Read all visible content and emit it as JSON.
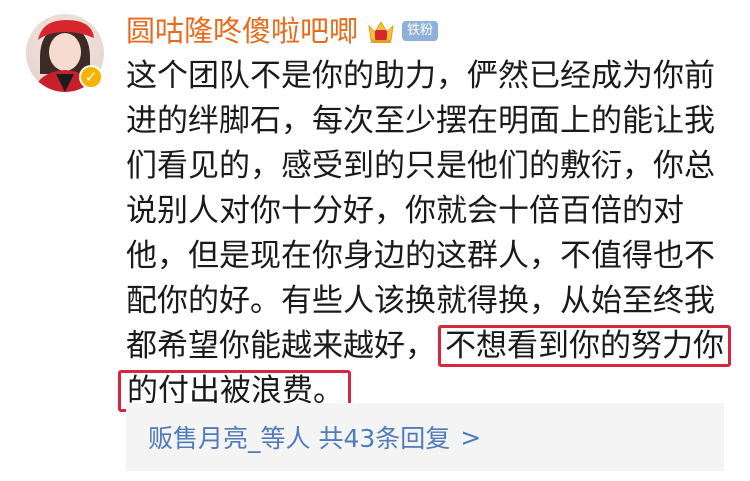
{
  "comment": {
    "username": "圆咕隆咚傻啦吧唧",
    "fan_badge": "铁粉",
    "text_lines": [
      "这个团队不是你的助力，俨然已经成为你前",
      "进的绊脚石，每次至少摆在明面上的能让我",
      "们看见的，感受到的只是他们的敷衍，你总",
      "说别人对你十分好，你就会十倍百倍的对",
      "他，但是现在你身边的这群人，不值得也不",
      "配你的好。有些人该换就得换，从始至终我"
    ],
    "line7_plain": "都希望你能越来越好，",
    "highlight_1": "不想看到你的努力你",
    "highlight_2": "的付出被浪费。",
    "replies_summary": "贩售月亮_等人 共43条回复",
    "replies_arrow": ">"
  },
  "colors": {
    "username": "#e86b1d",
    "highlight_border": "#d7263d",
    "link": "#4f7cb8",
    "verified": "#f4b400",
    "fan_badge_bg": "#8fb1d9"
  }
}
